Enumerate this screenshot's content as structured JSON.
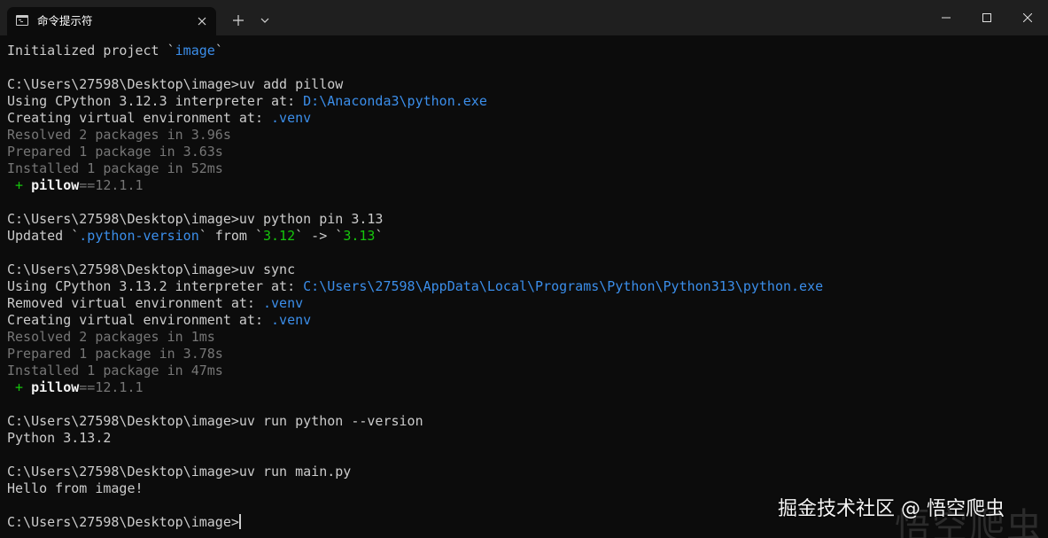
{
  "window": {
    "tab_title": "命令提示符",
    "tab_icon": "terminal-icon",
    "close_tab_icon": "close-icon",
    "new_tab_label": "+",
    "dropdown_icon": "chevron-down-icon",
    "minimize_icon": "minimize-icon",
    "maximize_icon": "maximize-icon",
    "close_icon": "close-icon"
  },
  "colors": {
    "background": "#0c0c0c",
    "titlebar": "#1f1f1f",
    "text": "#cccccc",
    "accent_blue": "#3b8eea",
    "dim": "#767676",
    "green": "#16c60c"
  },
  "terminal": {
    "lines": [
      {
        "segments": [
          {
            "text": "Initialized project `"
          },
          {
            "text": "image",
            "style": "blue"
          },
          {
            "text": "`"
          }
        ]
      },
      {
        "segments": []
      },
      {
        "segments": [
          {
            "text": "C:\\Users\\27598\\Desktop\\image>uv add pillow"
          }
        ]
      },
      {
        "segments": [
          {
            "text": "Using CPython 3.12.3 interpreter at: "
          },
          {
            "text": "D:\\Anaconda3\\python.exe",
            "style": "blue"
          }
        ]
      },
      {
        "segments": [
          {
            "text": "Creating virtual environment at: "
          },
          {
            "text": ".venv",
            "style": "blue"
          }
        ]
      },
      {
        "segments": [
          {
            "text": "Resolved 2 packages in 3.96s",
            "style": "dim"
          }
        ]
      },
      {
        "segments": [
          {
            "text": "Prepared 1 package in 3.63s",
            "style": "dim"
          }
        ]
      },
      {
        "segments": [
          {
            "text": "Installed 1 package in 52ms",
            "style": "dim"
          }
        ]
      },
      {
        "segments": [
          {
            "text": " + ",
            "style": "green"
          },
          {
            "text": "pillow",
            "style": "bold"
          },
          {
            "text": "==12.1.1",
            "style": "dim"
          }
        ]
      },
      {
        "segments": []
      },
      {
        "segments": [
          {
            "text": "C:\\Users\\27598\\Desktop\\image>uv python pin 3.13"
          }
        ]
      },
      {
        "segments": [
          {
            "text": "Updated `"
          },
          {
            "text": ".python-version",
            "style": "blue"
          },
          {
            "text": "` from `"
          },
          {
            "text": "3.12",
            "style": "green"
          },
          {
            "text": "` -> `"
          },
          {
            "text": "3.13",
            "style": "green"
          },
          {
            "text": "`"
          }
        ]
      },
      {
        "segments": []
      },
      {
        "segments": [
          {
            "text": "C:\\Users\\27598\\Desktop\\image>uv sync"
          }
        ]
      },
      {
        "segments": [
          {
            "text": "Using CPython 3.13.2 interpreter at: "
          },
          {
            "text": "C:\\Users\\27598\\AppData\\Local\\Programs\\Python\\Python313\\python.exe",
            "style": "blue"
          }
        ]
      },
      {
        "segments": [
          {
            "text": "Removed virtual environment at: "
          },
          {
            "text": ".venv",
            "style": "blue"
          }
        ]
      },
      {
        "segments": [
          {
            "text": "Creating virtual environment at: "
          },
          {
            "text": ".venv",
            "style": "blue"
          }
        ]
      },
      {
        "segments": [
          {
            "text": "Resolved 2 packages in 1ms",
            "style": "dim"
          }
        ]
      },
      {
        "segments": [
          {
            "text": "Prepared 1 package in 3.78s",
            "style": "dim"
          }
        ]
      },
      {
        "segments": [
          {
            "text": "Installed 1 package in 47ms",
            "style": "dim"
          }
        ]
      },
      {
        "segments": [
          {
            "text": " + ",
            "style": "green"
          },
          {
            "text": "pillow",
            "style": "bold"
          },
          {
            "text": "==12.1.1",
            "style": "dim"
          }
        ]
      },
      {
        "segments": []
      },
      {
        "segments": [
          {
            "text": "C:\\Users\\27598\\Desktop\\image>uv run python --version"
          }
        ]
      },
      {
        "segments": [
          {
            "text": "Python 3.13.2"
          }
        ]
      },
      {
        "segments": []
      },
      {
        "segments": [
          {
            "text": "C:\\Users\\27598\\Desktop\\image>uv run main.py"
          }
        ]
      },
      {
        "segments": [
          {
            "text": "Hello from image!"
          }
        ]
      },
      {
        "segments": []
      }
    ],
    "prompt": "C:\\Users\\27598\\Desktop\\image>"
  },
  "watermark": {
    "text": "掘金技术社区 @ 悟空爬虫",
    "faded_text": "悟空爬虫"
  }
}
